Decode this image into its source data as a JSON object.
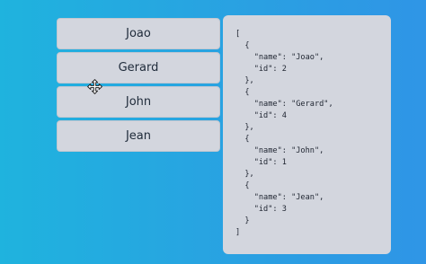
{
  "list": {
    "items": [
      {
        "label": "Joao"
      },
      {
        "label": "Gerard"
      },
      {
        "label": "John"
      },
      {
        "label": "Jean"
      }
    ]
  },
  "json_output": {
    "text": "[\n  {\n    \"name\": \"Joao\",\n    \"id\": 2\n  },\n  {\n    \"name\": \"Gerard\",\n    \"id\": 4\n  },\n  {\n    \"name\": \"John\",\n    \"id\": 1\n  },\n  {\n    \"name\": \"Jean\",\n    \"id\": 3\n  }\n]"
  },
  "cursor": {
    "icon": "move-cursor-icon"
  }
}
